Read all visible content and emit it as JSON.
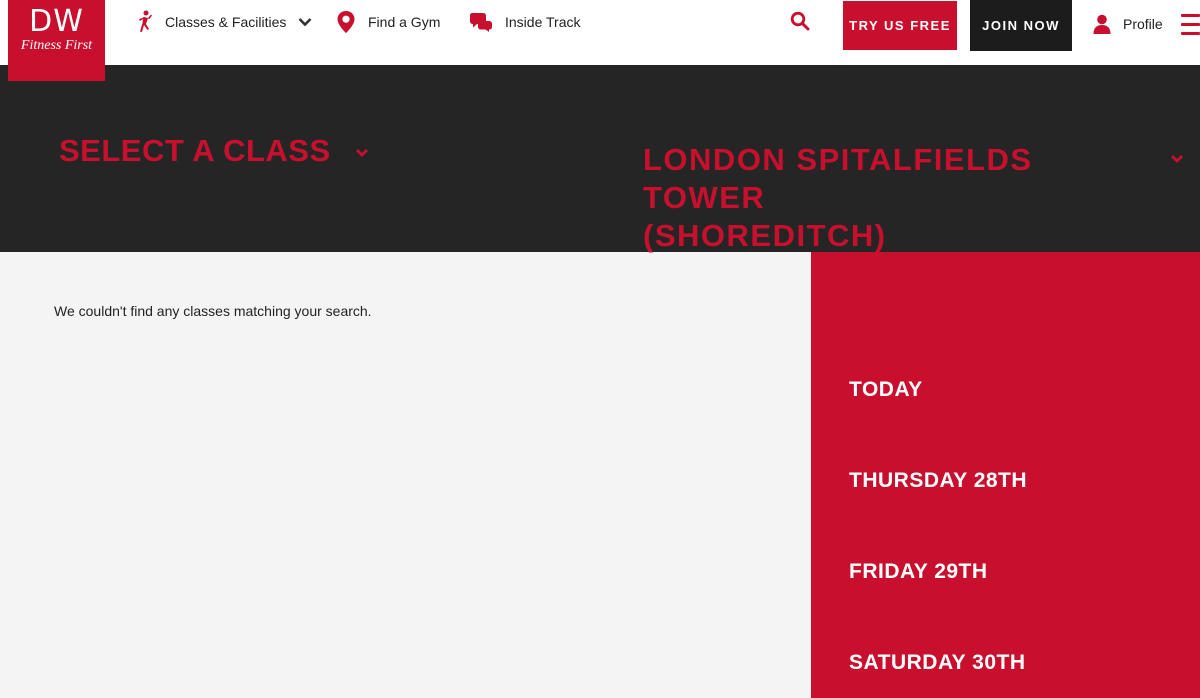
{
  "header": {
    "logo": {
      "line1": "DW",
      "line2": "Fitness First"
    },
    "nav": [
      {
        "label": "Classes & Facilities",
        "icon": "runner-icon",
        "has_dropdown": true
      },
      {
        "label": "Find a Gym",
        "icon": "location-pin-icon",
        "has_dropdown": false
      },
      {
        "label": "Inside Track",
        "icon": "chat-bubble-icon",
        "has_dropdown": false
      }
    ],
    "search_icon": "search-icon",
    "try_button": "TRY US FREE",
    "join_button": "JOIN NOW",
    "profile_label": "Profile",
    "profile_icon": "user-icon",
    "menu_icon": "hamburger-menu-icon"
  },
  "filters": {
    "class_select_label": "SELECT A CLASS",
    "location_line1": "LONDON SPITALFIELDS TOWER",
    "location_line2": "(SHOREDITCH)"
  },
  "results": {
    "empty_message": "We couldn't find any classes matching your search."
  },
  "days": [
    {
      "label": "TODAY"
    },
    {
      "label": "THURSDAY 28TH"
    },
    {
      "label": "FRIDAY 29TH"
    },
    {
      "label": "SATURDAY 30TH"
    }
  ],
  "colors": {
    "brand_red": "#c8102e",
    "dark_band": "#252525",
    "join_button": "#1c1c1c",
    "content_bg": "#f4f4f4"
  }
}
